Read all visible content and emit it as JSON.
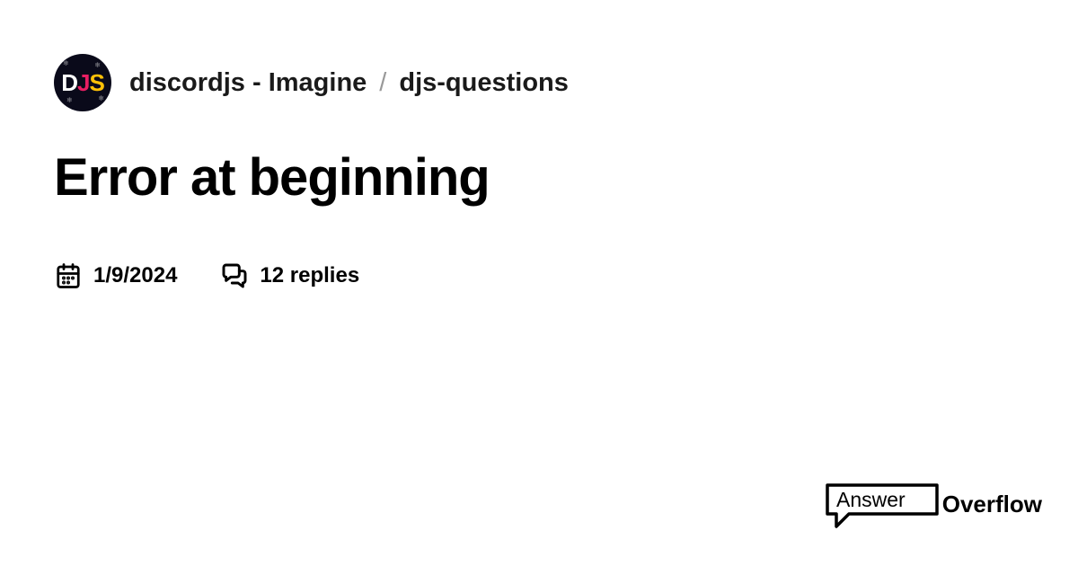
{
  "breadcrumb": {
    "server": "discordjs - Imagine",
    "separator": "/",
    "channel": "djs-questions"
  },
  "avatar": {
    "letters": {
      "d": "D",
      "j": "J",
      "s": "S"
    }
  },
  "title": "Error at beginning",
  "meta": {
    "date": "1/9/2024",
    "replies": "12 replies"
  },
  "footer": {
    "logo_part1": "Answer",
    "logo_part2": "Overflow"
  }
}
